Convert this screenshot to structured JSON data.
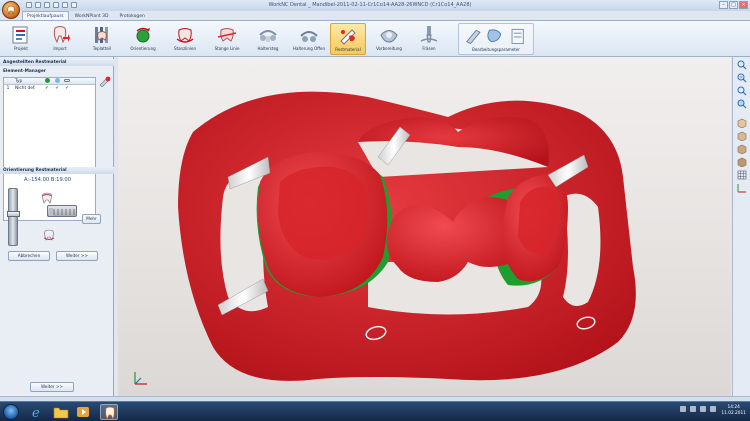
{
  "window": {
    "title": "WorkNC  Dental  _  Mandibel-2011-02-11-Cr1Co14-AA28-26WNCD  (Cr1Co14_AA28)",
    "controls": {
      "minimize": "–",
      "maximize": "□",
      "close": "×"
    }
  },
  "tabs": [
    {
      "label": "Projektlaufpaurs",
      "active": true
    },
    {
      "label": "WorkNPlant 3D",
      "active": false
    },
    {
      "label": "Protokogen",
      "active": false
    }
  ],
  "ribbon": {
    "buttons": [
      {
        "label": "Projekt"
      },
      {
        "label": "Import"
      },
      {
        "label": "Teplatteil"
      },
      {
        "label": "Orientierung"
      },
      {
        "label": "Stanzlinien"
      },
      {
        "label": "Stange Linie"
      },
      {
        "label": "Haltersteg"
      },
      {
        "label": "Halterung Offen"
      },
      {
        "label": "Restmaterial",
        "active": true
      },
      {
        "label": "Vorbereitung"
      },
      {
        "label": "Fräsen"
      },
      {
        "label": "Bearbeitungsparameter",
        "grouped": true
      }
    ]
  },
  "left_panel": {
    "section1_title": "Angestellten Restmaterial",
    "element_manager_title": "Element-Manager",
    "table": {
      "header": [
        "",
        "Typ",
        "",
        "",
        ""
      ],
      "rows": [
        {
          "index": "1",
          "type": "Nicht def.",
          "checks": [
            "✔",
            "✔",
            "✔"
          ]
        }
      ]
    },
    "orientation_title": "Orientierung Restmaterial",
    "angles": "A:-154.00   B:19.00",
    "mehr_label": "Mehr",
    "abbrechen_label": "Abbrechen",
    "weiter_label": "Weiter >>",
    "weiter_bottom_label": "Weiter >>"
  },
  "taskbar": {
    "time": "14:24",
    "date": "11.02.2011"
  },
  "colors": {
    "model_red": "#c8141c",
    "model_bright_red": "#e0262c",
    "model_green": "#1f9d2e",
    "connector_white": "#f2f2f2",
    "ribbon_active": "#f7c95a"
  }
}
